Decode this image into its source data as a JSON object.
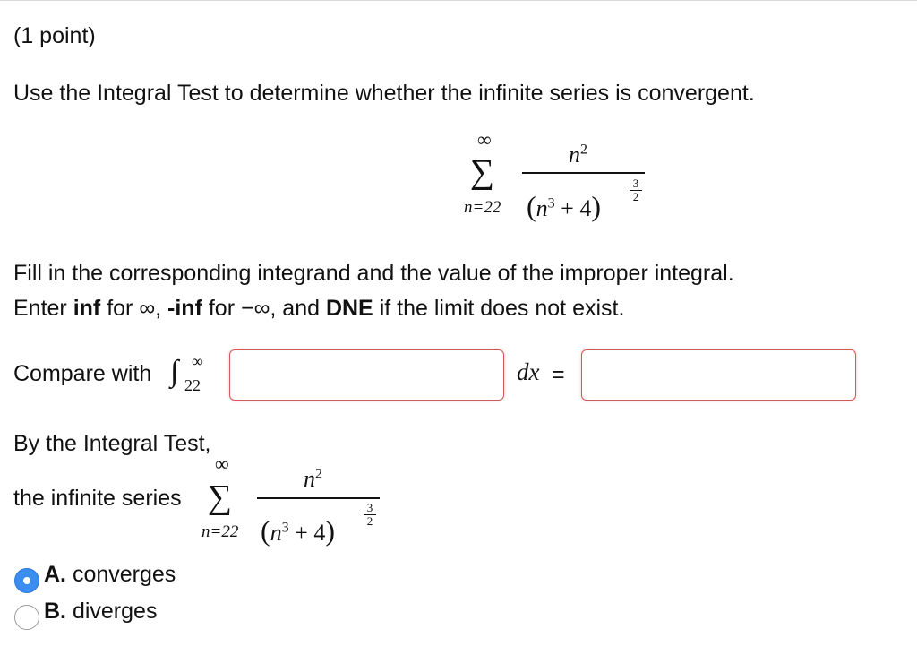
{
  "problem": {
    "points": "(1 point)",
    "instruction": "Use the Integral Test to determine whether the infinite series is convergent."
  },
  "series": {
    "upper": "∞",
    "sigma": "∑",
    "lower": "n=22",
    "numerator_base": "n",
    "numerator_exp": "2",
    "denom_open": "(",
    "denom_base": "n",
    "denom_exp": "3",
    "denom_rest": " + 4",
    "denom_close": ")",
    "outer_exp_num": "3",
    "outer_exp_den": "2"
  },
  "fill": {
    "line1": "Fill in the corresponding integrand and the value of the improper integral.",
    "line2_a": "Enter ",
    "line2_inf": "inf",
    "line2_b": " for ∞, ",
    "line2_neginf": "-inf",
    "line2_c": " for −∞, and ",
    "line2_dne": "DNE",
    "line2_d": " if the limit does not exist."
  },
  "compare": {
    "label": "Compare with",
    "integral_sign": "∫",
    "upper": "∞",
    "lower": "22",
    "dx": "dx",
    "equals": "=",
    "integrand_value": "",
    "result_value": ""
  },
  "conclusion": {
    "line1": "By the Integral Test,",
    "line2": "the infinite series"
  },
  "options": [
    {
      "letter": "A.",
      "text": " converges",
      "selected": true
    },
    {
      "letter": "B.",
      "text": " diverges",
      "selected": false
    }
  ],
  "colors": {
    "input_border": "#d25a5a",
    "radio_selected": "#3b8df0"
  }
}
